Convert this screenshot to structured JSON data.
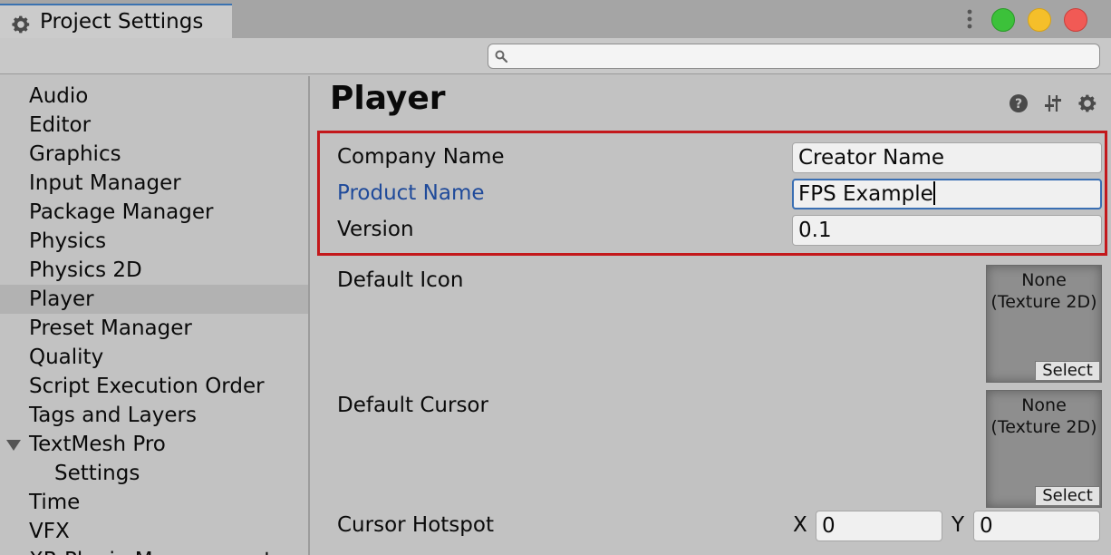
{
  "window": {
    "tab_title": "Project Settings"
  },
  "search": {
    "placeholder": "",
    "value": ""
  },
  "sidebar": {
    "items": [
      {
        "label": "Audio"
      },
      {
        "label": "Editor"
      },
      {
        "label": "Graphics"
      },
      {
        "label": "Input Manager"
      },
      {
        "label": "Package Manager"
      },
      {
        "label": "Physics"
      },
      {
        "label": "Physics 2D"
      },
      {
        "label": "Player",
        "selected": true
      },
      {
        "label": "Preset Manager"
      },
      {
        "label": "Quality"
      },
      {
        "label": "Script Execution Order"
      },
      {
        "label": "Tags and Layers"
      },
      {
        "label": "TextMesh Pro",
        "expanded": true
      },
      {
        "label": "Settings",
        "child": true
      },
      {
        "label": "Time"
      },
      {
        "label": "VFX"
      },
      {
        "label": "XR Plugin Management"
      }
    ]
  },
  "main": {
    "title": "Player",
    "header_icons": [
      "help-icon",
      "sliders-icon",
      "gear-icon"
    ],
    "company_name": {
      "label": "Company Name",
      "value": "Creator Name"
    },
    "product_name": {
      "label": "Product Name",
      "value": "FPS Example"
    },
    "version": {
      "label": "Version",
      "value": "0.1"
    },
    "default_icon": {
      "label": "Default Icon",
      "value_line1": "None",
      "value_line2": "(Texture 2D)",
      "button": "Select"
    },
    "default_cursor": {
      "label": "Default Cursor",
      "value_line1": "None",
      "value_line2": "(Texture 2D)",
      "button": "Select"
    },
    "cursor_hotspot": {
      "label": "Cursor Hotspot",
      "x_label": "X",
      "x_value": "0",
      "y_label": "Y",
      "y_value": "0"
    }
  },
  "colors": {
    "highlight_border": "#c3181b",
    "modified_label": "#1f4a9a",
    "focus_border": "#3a6fb3",
    "traffic_green": "#3cc13a",
    "traffic_yellow": "#f5bf2a",
    "traffic_red": "#f15a55"
  }
}
